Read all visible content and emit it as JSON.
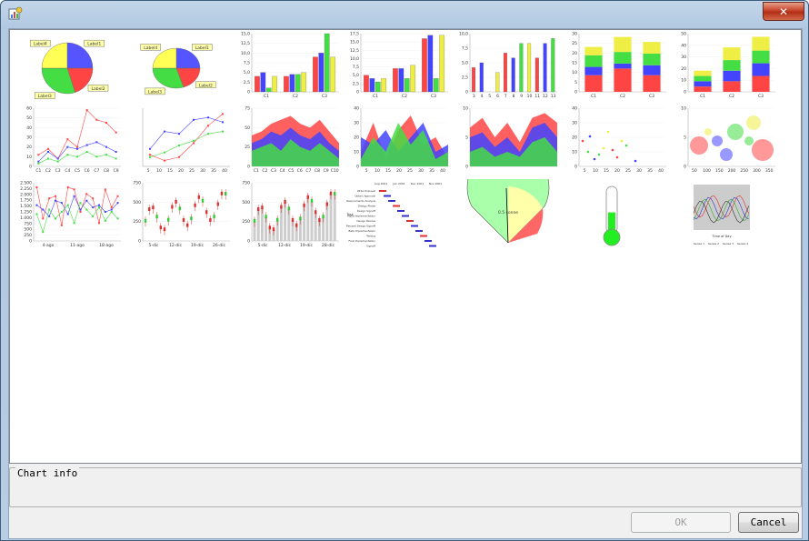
{
  "window": {
    "title": "",
    "close_glyph": "✕"
  },
  "info": {
    "label": "Chart info"
  },
  "buttons": {
    "ok": "OK",
    "cancel": "Cancel"
  },
  "chart_data": [
    {
      "type": "pie",
      "labels": [
        "Label1",
        "Label2",
        "Label3",
        "Label4"
      ],
      "values": [
        25,
        20,
        30,
        25
      ],
      "colors": [
        "#5555ff",
        "#ff4444",
        "#44dd44",
        "#ffff55"
      ],
      "title": ""
    },
    {
      "type": "pie",
      "labels": [
        "Label1",
        "Label2",
        "Label3",
        "Label4"
      ],
      "values": [
        25,
        20,
        30,
        25
      ],
      "colors": [
        "#5555ff",
        "#ff4444",
        "#44dd44",
        "#ffff55"
      ],
      "title": ""
    },
    {
      "type": "bar",
      "categories": [
        "C1",
        "C2",
        "C3"
      ],
      "yticks": [
        "0",
        "2,5",
        "5,0",
        "7,5",
        "10,0",
        "12,5",
        "15,0"
      ],
      "ylim": [
        0,
        15
      ],
      "series": [
        {
          "values": [
            4,
            4,
            9
          ]
        },
        {
          "values": [
            5,
            4.5,
            10
          ]
        },
        {
          "values": [
            1,
            4.5,
            15
          ]
        },
        {
          "values": [
            4,
            5,
            9
          ]
        }
      ]
    },
    {
      "type": "bar",
      "categories": [
        "C1",
        "C2",
        "C3"
      ],
      "yticks": [
        "0",
        "2,5",
        "5,0",
        "7,5",
        "10,0",
        "12,5",
        "15,0",
        "17,5"
      ],
      "ylim": [
        0,
        17.5
      ],
      "series": [
        {
          "values": [
            5,
            7,
            16
          ]
        },
        {
          "values": [
            4,
            7,
            17
          ]
        },
        {
          "values": [
            3,
            4,
            4
          ]
        },
        {
          "values": [
            4,
            8,
            17
          ]
        }
      ]
    },
    {
      "type": "bar",
      "categories": [
        "3",
        "4",
        "5",
        "6",
        "7",
        "8",
        "9",
        "10",
        "11",
        "12",
        "13"
      ],
      "yticks": [
        "0",
        "2,5",
        "5,0",
        "7,5",
        "10,0"
      ],
      "ylim": [
        0,
        12
      ],
      "series": [
        {
          "values": [
            5,
            6,
            0,
            4,
            8,
            7,
            10,
            10,
            7,
            10,
            11
          ]
        }
      ]
    },
    {
      "type": "stacked-bar",
      "categories": [
        "C1",
        "C2",
        "C3"
      ],
      "yticks": [
        "0",
        "5",
        "10",
        "15",
        "20",
        "25",
        "30"
      ],
      "ylim": [
        0,
        35
      ],
      "series": [
        {
          "values": [
            10,
            14,
            10
          ]
        },
        {
          "values": [
            5,
            3,
            6
          ]
        },
        {
          "values": [
            7,
            7,
            7
          ]
        },
        {
          "values": [
            5,
            9,
            7
          ]
        }
      ]
    },
    {
      "type": "stacked-bar",
      "categories": [
        "C1",
        "C2",
        "C3"
      ],
      "yticks": [
        "0",
        "10",
        "20",
        "30",
        "40",
        "50"
      ],
      "ylim": [
        0,
        55
      ],
      "series": [
        {
          "values": [
            5,
            10,
            15
          ]
        },
        {
          "values": [
            5,
            10,
            12
          ]
        },
        {
          "values": [
            5,
            10,
            12
          ]
        },
        {
          "values": [
            5,
            12,
            13
          ]
        }
      ]
    },
    {
      "type": "line",
      "categories": [
        "C1",
        "C2",
        "C3",
        "C4",
        "C5",
        "C6",
        "C7",
        "C8",
        "C9"
      ],
      "yticks": [
        "0",
        "10",
        "20",
        "30",
        "40",
        "50",
        "60"
      ],
      "ylim": [
        0,
        60
      ],
      "series": [
        {
          "values": [
            12,
            18,
            8,
            28,
            20,
            58,
            48,
            45,
            35
          ]
        },
        {
          "values": [
            5,
            15,
            8,
            20,
            18,
            22,
            25,
            20,
            15
          ]
        },
        {
          "values": [
            3,
            8,
            5,
            12,
            10,
            15,
            10,
            12,
            8
          ]
        }
      ]
    },
    {
      "type": "line",
      "xticks": [
        "5",
        "10",
        "15",
        "20",
        "25",
        "30",
        "35",
        "40"
      ],
      "ylim": [
        0,
        50
      ],
      "series": [
        {
          "values": [
            10,
            5,
            8,
            20,
            35,
            45
          ]
        },
        {
          "values": [
            15,
            30,
            28,
            40,
            42,
            38
          ]
        },
        {
          "values": [
            8,
            12,
            18,
            22,
            28,
            30
          ]
        }
      ]
    },
    {
      "type": "area",
      "categories": [
        "C1",
        "C2",
        "C3",
        "C4",
        "C5",
        "C6",
        "C7",
        "C8",
        "C9",
        "C10"
      ],
      "yticks": [
        "0",
        "25",
        "50",
        "75"
      ],
      "ylim": [
        0,
        75
      ],
      "series": [
        {
          "values": [
            40,
            45,
            55,
            60,
            65,
            55,
            50,
            60,
            45,
            30
          ]
        },
        {
          "values": [
            30,
            35,
            45,
            40,
            50,
            40,
            35,
            45,
            30,
            20
          ]
        },
        {
          "values": [
            20,
            25,
            30,
            20,
            35,
            25,
            20,
            30,
            20,
            10
          ]
        }
      ]
    },
    {
      "type": "area",
      "xticks": [
        "5",
        "10",
        "15",
        "20",
        "25",
        "30",
        "35",
        "40"
      ],
      "yticks": [
        "0",
        "10",
        "20",
        "30",
        "40"
      ],
      "ylim": [
        0,
        40
      ],
      "series": [
        {
          "values": [
            10,
            30,
            5,
            25,
            35,
            15,
            20,
            5
          ]
        },
        {
          "values": [
            20,
            15,
            25,
            10,
            20,
            30,
            10,
            15
          ]
        },
        {
          "values": [
            5,
            20,
            10,
            30,
            15,
            25,
            5,
            10
          ]
        }
      ]
    },
    {
      "type": "area",
      "yticks": [
        "0",
        "5",
        "10"
      ],
      "ylim": [
        0,
        12
      ],
      "series": [
        {
          "values": [
            8,
            10,
            6,
            9,
            5,
            10,
            11,
            9
          ]
        },
        {
          "values": [
            6,
            7,
            4,
            6,
            3,
            8,
            9,
            6
          ]
        },
        {
          "values": [
            3,
            4,
            2,
            3,
            2,
            5,
            6,
            3
          ]
        }
      ]
    },
    {
      "type": "scatter",
      "xticks": [
        "5",
        "10",
        "15",
        "20",
        "25",
        "30",
        "35",
        "40"
      ],
      "ylim": [
        0,
        40
      ],
      "series": [
        {
          "name": "",
          "values": []
        }
      ]
    },
    {
      "type": "bubble",
      "xticks": [
        "50",
        "100",
        "150",
        "200",
        "250",
        "300",
        "350"
      ],
      "yticks": [
        "0",
        "5",
        "10"
      ],
      "ylim": [
        0,
        12
      ],
      "series": []
    },
    {
      "type": "line",
      "xticks": [
        "4-ago",
        "11-ago",
        "18-ago"
      ],
      "yticks": [
        "0",
        "250",
        "500",
        "750",
        "1.000",
        "1.250",
        "1.500",
        "1.750",
        "2.000",
        "2.250",
        "2.500"
      ],
      "ylim": [
        0,
        2600
      ],
      "series": [
        {
          "values": [
            2400,
            1000,
            1900,
            2000,
            700,
            2400,
            2300,
            1300,
            2100,
            1900,
            800,
            2300,
            1500,
            2000
          ]
        },
        {
          "values": [
            1600,
            1400,
            1100,
            1800,
            1700,
            1200,
            2000,
            1400,
            1800,
            1500,
            1600,
            1300,
            1400,
            1700
          ]
        },
        {
          "values": [
            1200,
            400,
            1400,
            1000,
            1300,
            1600,
            800,
            1700,
            1400,
            1100,
            1500,
            900,
            1300,
            1000
          ]
        }
      ]
    },
    {
      "type": "candlestick",
      "xticks": [
        "5-dic",
        "12-dic",
        "19-dic",
        "26-dic"
      ],
      "yticks": [
        "0",
        "250",
        "500",
        "750"
      ],
      "ylim": [
        0,
        900
      ]
    },
    {
      "type": "candlestick",
      "xticks": [
        "5-dic",
        "12-dic",
        "19-dic",
        "28-dic"
      ],
      "yticks": [
        "0",
        "250",
        "500",
        "750"
      ],
      "ylim": [
        0,
        900
      ]
    },
    {
      "type": "gantt",
      "title": "",
      "ylabel": "Task",
      "xticks": [
        "Aug 2001",
        "Jan 2001",
        "Dec 2001",
        "Nov 2001"
      ],
      "tasks": [
        "Write Proposal",
        "Obtain Approval",
        "Requirements Analysis",
        "Design Phase",
        "Design Signoff",
        "Alpha Implementation",
        "Design Review",
        "Revised Design Signoff",
        "Beta Implementation",
        "Testing",
        "Final Implementation",
        "Signoff"
      ]
    },
    {
      "type": "dial",
      "label": "0.5 sonne",
      "ylim": [
        0,
        1
      ]
    },
    {
      "type": "thermometer",
      "value": 0.45,
      "ylim": [
        0,
        1
      ]
    },
    {
      "type": "line",
      "title": "",
      "xlabel": "Time of Day",
      "ylabel_left": "Primary Axis",
      "ylabel_right": "Secondary Axis",
      "legend": [
        "Series 1",
        "Series 2",
        "Series 3",
        "Series 4"
      ],
      "legend_position": "bottom"
    }
  ]
}
